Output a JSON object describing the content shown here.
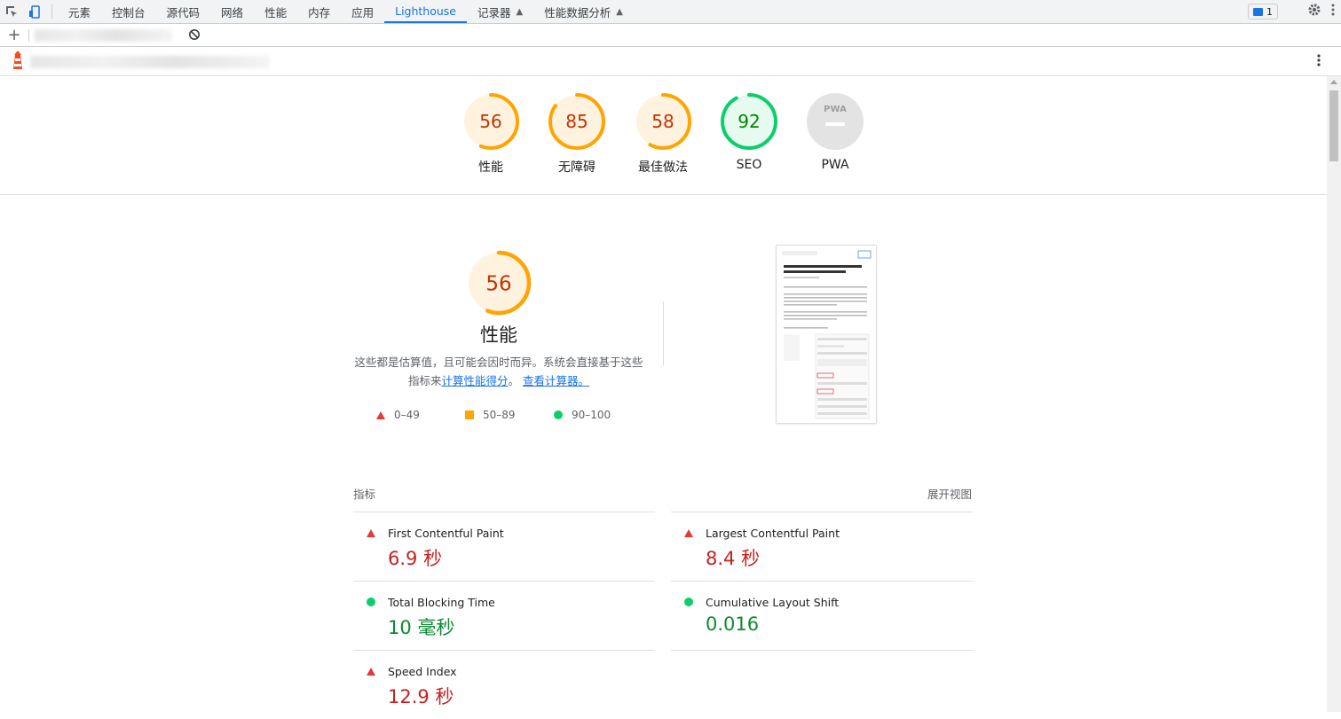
{
  "devtools": {
    "tabs": [
      {
        "label": "元素"
      },
      {
        "label": "控制台"
      },
      {
        "label": "源代码"
      },
      {
        "label": "网络"
      },
      {
        "label": "性能"
      },
      {
        "label": "内存"
      },
      {
        "label": "应用"
      },
      {
        "label": "Lighthouse"
      },
      {
        "label": "记录器"
      },
      {
        "label": "性能数据分析"
      }
    ],
    "active_tab": "Lighthouse",
    "issues_count": "1",
    "accent_color": "#1a73e8"
  },
  "gauges": [
    {
      "label": "性能",
      "score": "56",
      "fraction": 0.56,
      "status": "average"
    },
    {
      "label": "无障碍",
      "score": "85",
      "fraction": 0.85,
      "status": "average"
    },
    {
      "label": "最佳做法",
      "score": "58",
      "fraction": 0.58,
      "status": "average"
    },
    {
      "label": "SEO",
      "score": "92",
      "fraction": 0.92,
      "status": "pass"
    },
    {
      "label": "PWA",
      "score": "PWA",
      "status": "na"
    }
  ],
  "performance": {
    "score": "56",
    "fraction": 0.56,
    "title": "性能",
    "desc_part1": "这些都是估算值，且可能会因时而异。系统会直接基于这些指标来",
    "link1": "计算性能得分",
    "desc_part2": "。",
    "link2": "查看计算器。",
    "legend": {
      "fail": "0–49",
      "average": "50–89",
      "pass": "90–100"
    }
  },
  "metrics": {
    "header": "指标",
    "toggle": "展开视图",
    "items": [
      {
        "name": "First Contentful Paint",
        "value": "6.9 秒",
        "status": "fail"
      },
      {
        "name": "Largest Contentful Paint",
        "value": "8.4 秒",
        "status": "fail"
      },
      {
        "name": "Total Blocking Time",
        "value": "10 毫秒",
        "status": "pass"
      },
      {
        "name": "Cumulative Layout Shift",
        "value": "0.016",
        "status": "pass"
      },
      {
        "name": "Speed Index",
        "value": "12.9 秒",
        "status": "fail"
      }
    ]
  },
  "colors": {
    "fail": "#e53935",
    "average": "#ffa400",
    "pass": "#0cce6b",
    "average_text": "#c33300",
    "pass_text": "#008800"
  }
}
